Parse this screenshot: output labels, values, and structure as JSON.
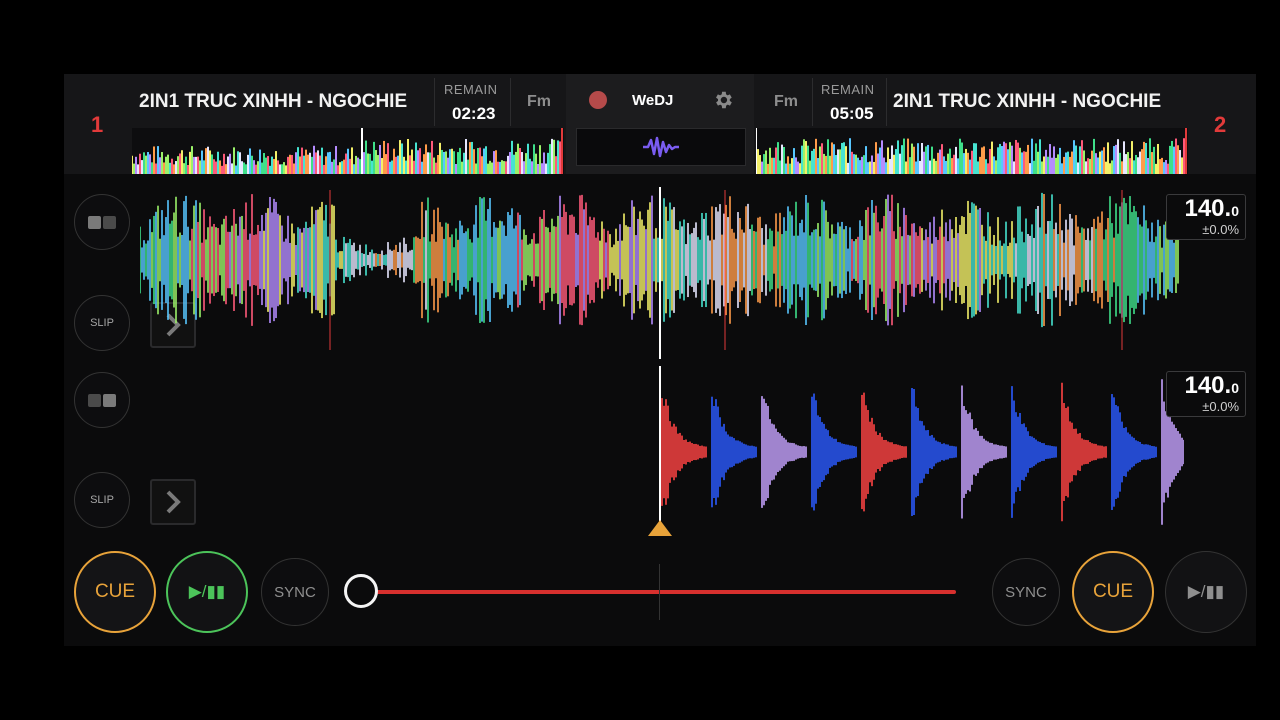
{
  "deck1": {
    "number": "1",
    "title": "2IN1 TRUC XINHH - NGOCHIE",
    "remain_label": "REMAIN",
    "remain_time": "02:23",
    "key": "Fm",
    "bpm_int": "140.",
    "bpm_dec": "0",
    "pitch": "±0.0%",
    "slip": "SLIP",
    "cue": "CUE",
    "play": "▶/▮▮",
    "sync": "SYNC",
    "state": "playing"
  },
  "deck2": {
    "number": "2",
    "title": "2IN1 TRUC XINHH - NGOCHIE",
    "remain_label": "REMAIN",
    "remain_time": "05:05",
    "key": "Fm",
    "bpm_int": "140.",
    "bpm_dec": "0",
    "pitch": "±0.0%",
    "slip": "SLIP",
    "cue": "CUE",
    "play": "▶/▮▮",
    "sync": "SYNC",
    "state": "paused"
  },
  "center": {
    "logo": "WeDJ",
    "record_icon": "record-icon",
    "settings_icon": "gear-icon",
    "fx_icon": "waveform-icon"
  },
  "crossfader": {
    "position": 0.0
  },
  "colors": {
    "accent_red": "#e23a3a",
    "cue_orange": "#e8a33a",
    "play_green": "#4cc45a",
    "fader_red": "#d7302e"
  }
}
